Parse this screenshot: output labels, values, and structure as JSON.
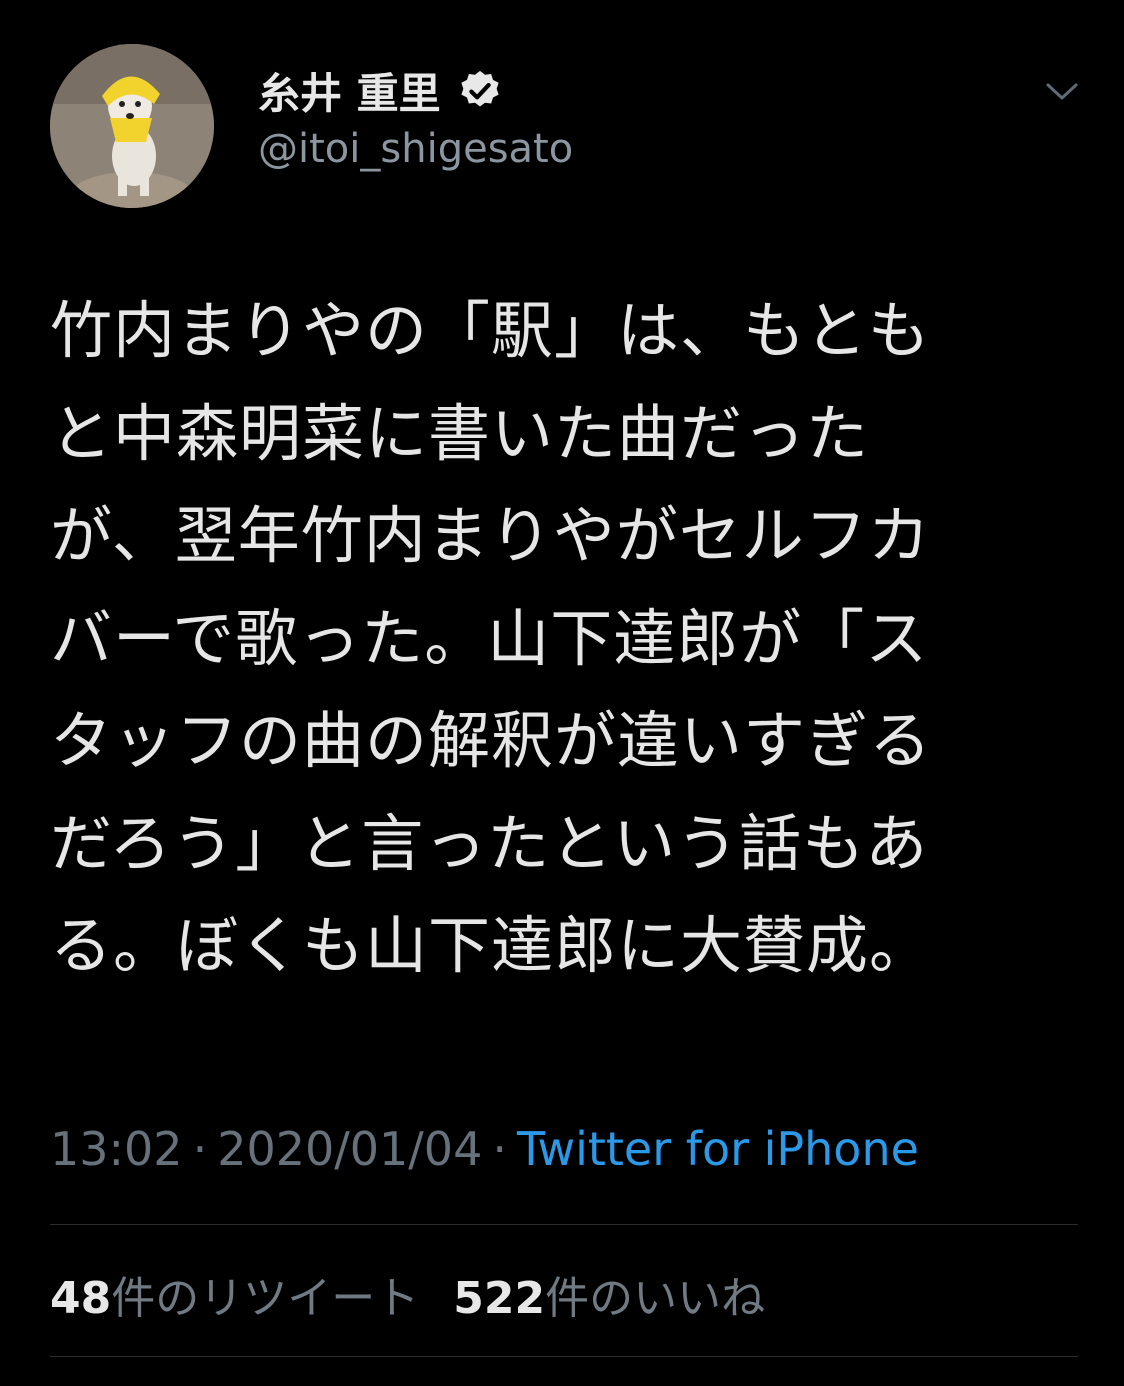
{
  "user": {
    "name": "糸井 重里",
    "handle": "@itoi_shigesato",
    "verified": true,
    "avatar": "dog-wearing-yellow-hood"
  },
  "icons": {
    "verified": "verified-badge-icon",
    "more": "chevron-down-icon"
  },
  "tweet": {
    "lines": [
      "竹内まりやの「駅」は、もとも",
      "と中森明菜に書いた曲だった",
      "が、翌年竹内まりやがセルフカ",
      "バーで歌った。山下達郎が「ス",
      "タッフの曲の解釈が違いすぎる",
      "だろう」と言ったという話もあ",
      "る。ぼくも山下達郎に大賛成。"
    ]
  },
  "meta": {
    "time": "13:02",
    "date": "2020/01/04",
    "separator": "·",
    "source": "Twitter for iPhone"
  },
  "stats": {
    "retweets_count": "48",
    "retweets_label": "件のリツイート",
    "likes_count": "522",
    "likes_label": "件のいいね"
  },
  "colors": {
    "background": "#000000",
    "text": "#e6e6e6",
    "secondary": "#66717b",
    "link": "#2b98e8",
    "divider": "#2a2d30"
  }
}
